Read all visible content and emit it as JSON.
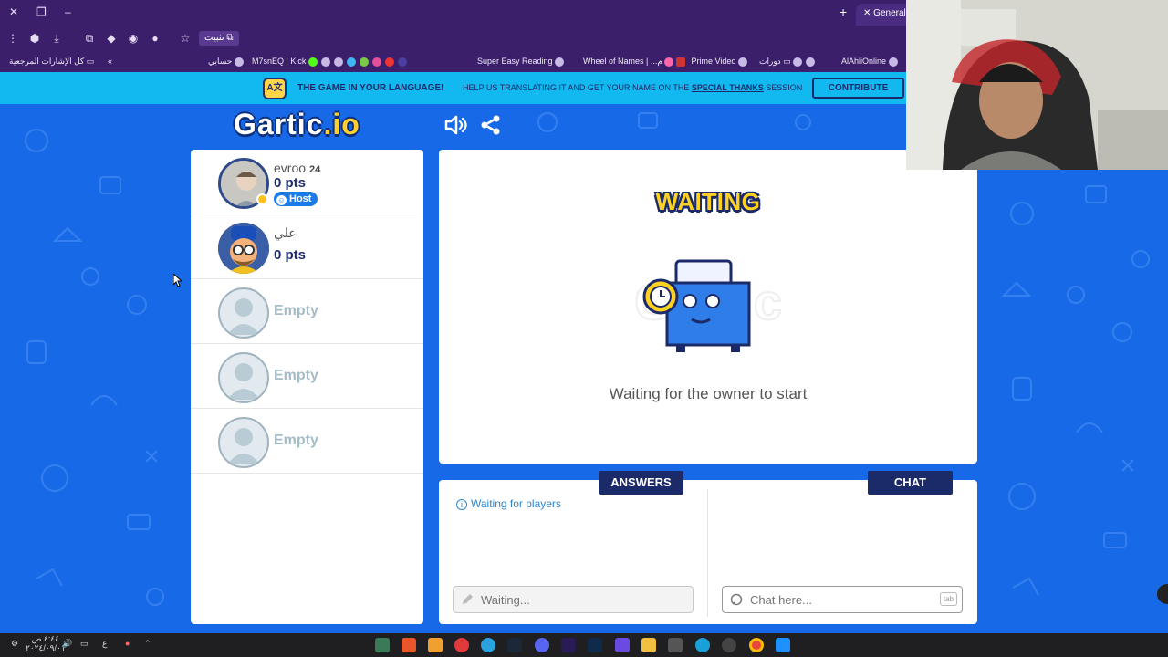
{
  "browser": {
    "tab_title": "General",
    "install_label": "تثبيت",
    "bookmarks": [
      {
        "label": "كل الإشارات المرجعية"
      },
      {
        "label": "حسابي"
      },
      {
        "label": "M7snEQ | Kick"
      },
      {
        "label": "Super Easy Reading"
      },
      {
        "label": "Wheel of Names | ...م"
      },
      {
        "label": "Prime Video"
      },
      {
        "label": "دورات"
      },
      {
        "label": "AlAhliOnline"
      }
    ]
  },
  "banner": {
    "headline": "THE GAME IN YOUR LANGUAGE!",
    "text_before": "HELP US TRANSLATING IT AND GET YOUR NAME ON THE",
    "link_text": "SPECIAL THANKS",
    "text_after": "SESSION",
    "contribute_label": "CONTRIBUTE"
  },
  "logo": {
    "text": "Gartic",
    "suffix": ".io"
  },
  "players": [
    {
      "name": "evroo",
      "level": "24",
      "points": "0 pts",
      "host_label": "Host"
    },
    {
      "name": "علي",
      "points": "0 pts"
    }
  ],
  "empty_slots": [
    "Empty",
    "Empty",
    "Empty"
  ],
  "game": {
    "status_title": "WAITING",
    "status_message": "Waiting for the owner to start",
    "watermark": "Gartic"
  },
  "answers": {
    "tab_label": "ANSWERS",
    "status": "Waiting for players",
    "input_placeholder": "Waiting..."
  },
  "chat": {
    "tab_label": "CHAT",
    "input_placeholder": "Chat here...",
    "tab_key_hint": "tab"
  },
  "taskbar": {
    "time": "٤:٤٤ ص",
    "date": "٢٠٢٤/٠٩/٠١",
    "lang": "ع"
  },
  "colors": {
    "background_blue": "#1769e8",
    "navy": "#1b2a68",
    "banner_cyan": "#12b8f0",
    "waiting_yellow": "#ffd21f",
    "browser_purple": "#3b1f6b"
  }
}
